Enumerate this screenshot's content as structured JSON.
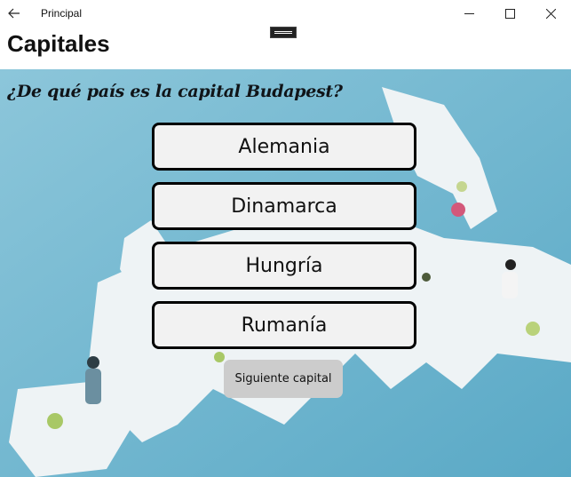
{
  "window": {
    "app_title": "Principal",
    "back_icon": "arrow-left-icon",
    "minimize_icon": "minimize-icon",
    "maximize_icon": "maximize-icon",
    "close_icon": "close-icon"
  },
  "page": {
    "title": "Capitales"
  },
  "quiz": {
    "question": "¿De qué país es la capital Budapest?",
    "answers": [
      {
        "label": "Alemania"
      },
      {
        "label": "Dinamarca"
      },
      {
        "label": "Hungría"
      },
      {
        "label": "Rumanía"
      }
    ],
    "next_label": "Siguiente capital"
  },
  "colors": {
    "background_water": "#6fb6d0",
    "land": "#eef3f5",
    "button_border": "#000000",
    "button_fill": "#f2f2f2",
    "next_fill": "#cccccc"
  }
}
